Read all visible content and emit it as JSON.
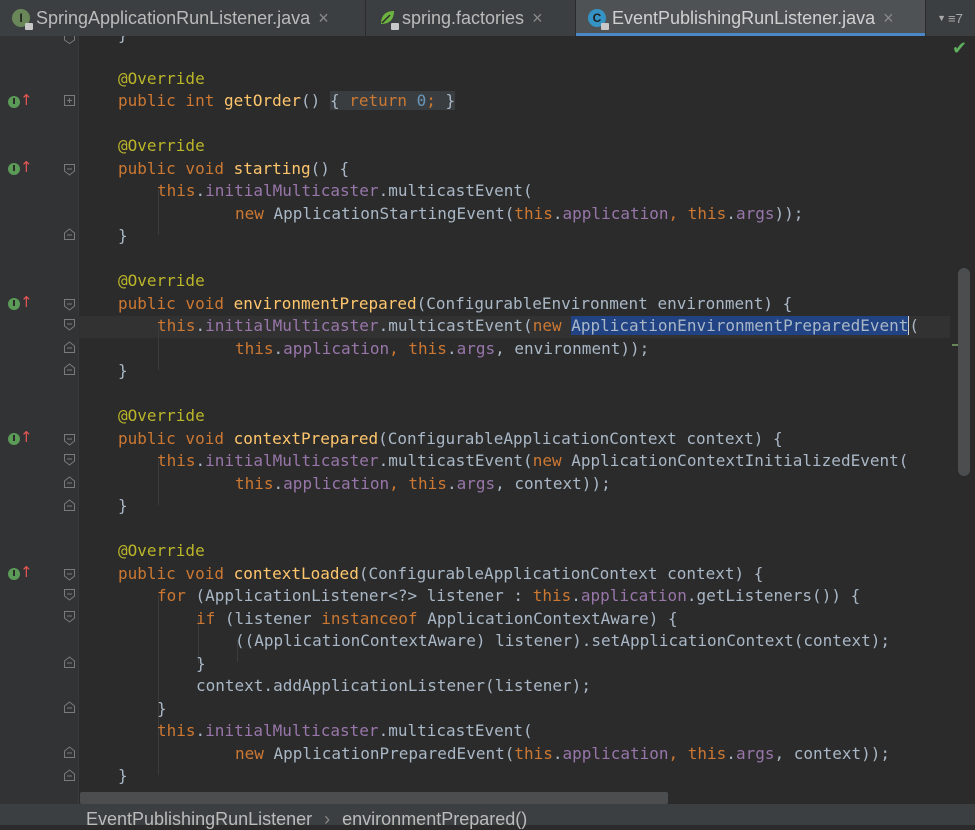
{
  "tabs": [
    {
      "label": "SpringApplicationRunListener.java",
      "icon_letter": "I",
      "icon": "interface-icon",
      "active": false
    },
    {
      "label": "spring.factories",
      "icon_letter": "",
      "icon": "spring-leaf-icon",
      "active": false
    },
    {
      "label": "EventPublishingRunListener.java",
      "icon_letter": "C",
      "icon": "class-icon",
      "active": true
    }
  ],
  "tab_close_glyph": "×",
  "tab_overflow": {
    "label": "7",
    "glyph": "≡"
  },
  "breadcrumb": [
    "EventPublishingRunListener",
    "environmentPrepared()"
  ],
  "breadcrumb_sep": "›",
  "code": {
    "l0": "}",
    "l1_ann": "@Override",
    "l2_kw": "public int ",
    "l2_fn": "getOrder",
    "l2_a": "() ",
    "l2_b": "{ ",
    "l2_kw2": "return ",
    "l2_num": "0",
    "l2_c": "; ",
    "l2_d": "}",
    "l3_ann": "@Override",
    "l4_kw": "public void ",
    "l4_fn": "starting",
    "l4_a": "() {",
    "l5_this": "this",
    "l5_dot": ".",
    "l5_fld": "initialMulticaster",
    "l5_a": ".multicastEvent(",
    "l6_new": "new ",
    "l6_a": "ApplicationStartingEvent(",
    "l6_this1": "this",
    "l6_b": ".",
    "l6_fld1": "application",
    "l6_c": ", ",
    "l6_this2": "this",
    "l6_d": ".",
    "l6_fld2": "args",
    "l6_e": "));",
    "l7": "}",
    "l8_ann": "@Override",
    "l9_kw": "public void ",
    "l9_fn": "environmentPrepared",
    "l9_a": "(ConfigurableEnvironment environment) {",
    "l10_this": "this",
    "l10_dot": ".",
    "l10_fld": "initialMulticaster",
    "l10_a": ".multicastEvent(",
    "l10_new": "new ",
    "l10_sel": "ApplicationEnvironmentPreparedEvent",
    "l10_b": "(",
    "l11_this1": "this",
    "l11_a": ".",
    "l11_fld1": "application",
    "l11_b": ", ",
    "l11_this2": "this",
    "l11_c": ".",
    "l11_fld2": "args",
    "l11_d": ", environment));",
    "l12": "}",
    "l13_ann": "@Override",
    "l14_kw": "public void ",
    "l14_fn": "contextPrepared",
    "l14_a": "(ConfigurableApplicationContext context) {",
    "l15_this": "this",
    "l15_dot": ".",
    "l15_fld": "initialMulticaster",
    "l15_a": ".multicastEvent(",
    "l15_new": "new ",
    "l15_b": "ApplicationContextInitializedEvent(",
    "l16_this1": "this",
    "l16_a": ".",
    "l16_fld1": "application",
    "l16_b": ", ",
    "l16_this2": "this",
    "l16_c": ".",
    "l16_fld2": "args",
    "l16_d": ", context));",
    "l17": "}",
    "l18_ann": "@Override",
    "l19_kw": "public void ",
    "l19_fn": "contextLoaded",
    "l19_a": "(ConfigurableApplicationContext context) {",
    "l20_kw": "for ",
    "l20_a": "(ApplicationListener<?> listener : ",
    "l20_this": "this",
    "l20_b": ".",
    "l20_fld": "application",
    "l20_c": ".getListeners()) {",
    "l21_kw": "if ",
    "l21_a": "(listener ",
    "l21_kw2": "instanceof ",
    "l21_b": "ApplicationContextAware) {",
    "l22": "((ApplicationContextAware) listener).setApplicationContext(context);",
    "l23": "}",
    "l24": "context.addApplicationListener(listener);",
    "l25": "}",
    "l26_this": "this",
    "l26_dot": ".",
    "l26_fld": "initialMulticaster",
    "l26_a": ".multicastEvent(",
    "l27_new": "new ",
    "l27_a": "ApplicationPreparedEvent(",
    "l27_this1": "this",
    "l27_b": ".",
    "l27_fld1": "application",
    "l27_c": ", ",
    "l27_this2": "this",
    "l27_d": ".",
    "l27_fld2": "args",
    "l27_e": ", context));",
    "l28": "}"
  },
  "colors": {
    "background": "#2B2B2B",
    "keyword": "#CC7832",
    "annotation": "#BBB529",
    "method": "#FFC66D",
    "field": "#9876AA",
    "number": "#6897BB",
    "selection": "#214283",
    "override_marker": "#5B9A57",
    "tab_underline": "#4A88C7"
  },
  "icons": {
    "gutter_marker": "implements-method-icon",
    "fold": "fold-icon",
    "status_ok": "check-icon"
  },
  "status_glyph": "✔"
}
